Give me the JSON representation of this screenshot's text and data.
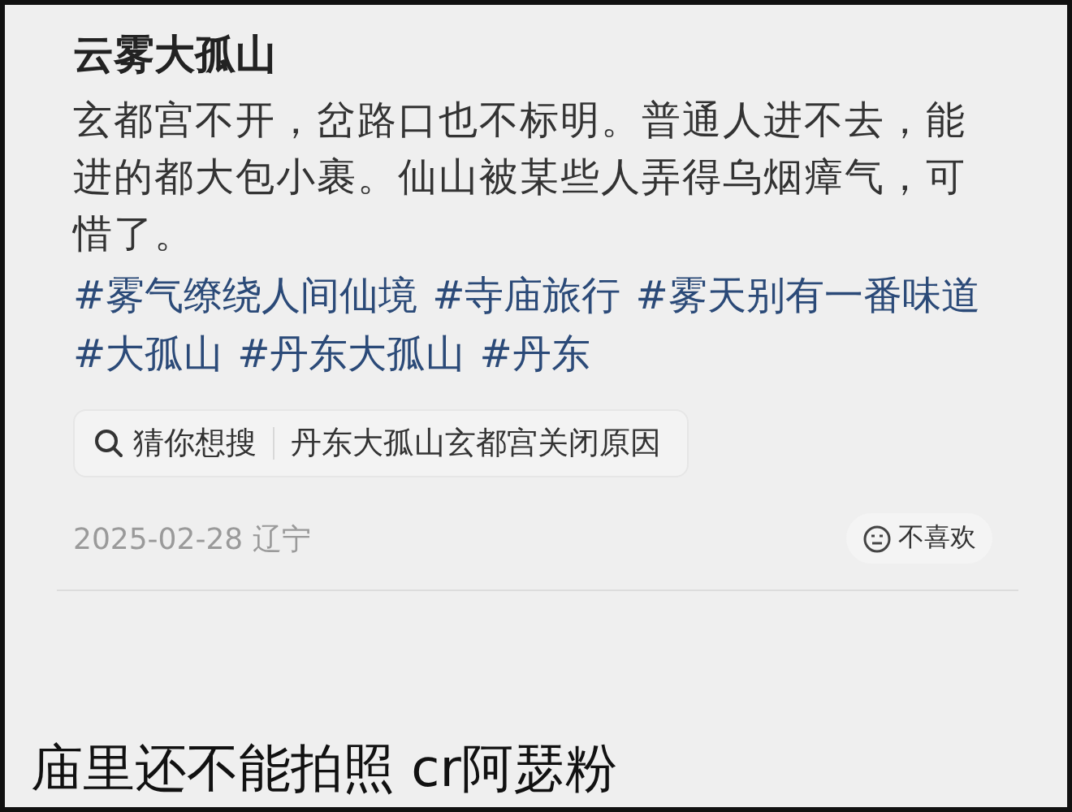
{
  "post": {
    "title": "云雾大孤山",
    "body": "玄都宫不开，岔路口也不标明。普通人进不去，能进的都大包小裹。仙山被某些人弄得乌烟瘴气，可惜了。",
    "hashtags": [
      "#雾气缭绕人间仙境",
      "#寺庙旅行",
      "#雾天别有一番味道",
      "#大孤山",
      "#丹东大孤山",
      "#丹东"
    ],
    "search_suggestion": {
      "label": "猜你想搜",
      "query": "丹东大孤山玄都宫关闭原因"
    },
    "date": "2025-02-28 辽宁",
    "dislike_button": "不喜欢"
  },
  "caption": "庙里还不能拍照 cr阿瑟粉"
}
